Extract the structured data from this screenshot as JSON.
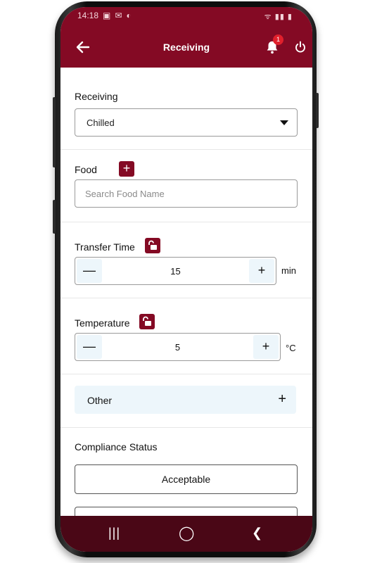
{
  "status_bar": {
    "time": "14:18",
    "icons": "ᯤ ▮▮ ▮"
  },
  "header": {
    "title": "Receiving",
    "notification_count": "1"
  },
  "receiving": {
    "label": "Receiving",
    "selected": "Chilled"
  },
  "food": {
    "label": "Food",
    "add_label": "+",
    "search_placeholder": "Search Food Name"
  },
  "transfer_time": {
    "label": "Transfer Time",
    "value": "15",
    "unit": "min",
    "decrement": "—",
    "increment": "+"
  },
  "temperature": {
    "label": "Temperature",
    "value": "5",
    "unit": "°C",
    "decrement": "—",
    "increment": "+"
  },
  "other": {
    "label": "Other",
    "toggle": "+"
  },
  "compliance": {
    "label": "Compliance Status",
    "option_acceptable": "Acceptable"
  },
  "navigation": {
    "recent": "|||",
    "home": "◯",
    "back": "❮"
  },
  "colors": {
    "brand": "#840a24",
    "nav": "#4a0716",
    "stepper_bg": "#edf6fb"
  }
}
